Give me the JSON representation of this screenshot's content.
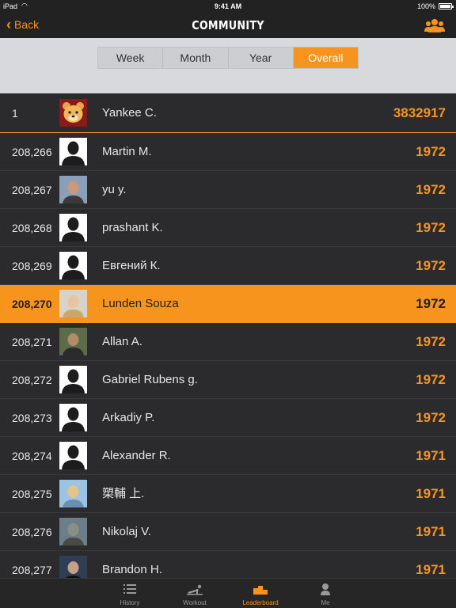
{
  "status_bar": {
    "carrier": "iPad",
    "time": "9:41 AM",
    "battery": "100%"
  },
  "nav": {
    "back_label": "Back",
    "title": "COMMUNITY",
    "right_icon": "group-icon"
  },
  "segments": [
    {
      "label": "Week",
      "active": false
    },
    {
      "label": "Month",
      "active": false
    },
    {
      "label": "Year",
      "active": false
    },
    {
      "label": "Overall",
      "active": true
    }
  ],
  "leaderboard": [
    {
      "rank": "1",
      "name": "Yankee C.",
      "score": "3832917",
      "avatar": "bear"
    },
    {
      "rank": "208,266",
      "name": "Martin M.",
      "score": "1972",
      "avatar": "silhouette"
    },
    {
      "rank": "208,267",
      "name": "yu y.",
      "score": "1972",
      "avatar": "photo"
    },
    {
      "rank": "208,268",
      "name": "prashant K.",
      "score": "1972",
      "avatar": "silhouette"
    },
    {
      "rank": "208,269",
      "name": "Евгений К.",
      "score": "1972",
      "avatar": "silhouette"
    },
    {
      "rank": "208,270",
      "name": "Lunden Souza",
      "score": "1972",
      "avatar": "photo"
    },
    {
      "rank": "208,271",
      "name": "Allan A.",
      "score": "1972",
      "avatar": "photo"
    },
    {
      "rank": "208,272",
      "name": "Gabriel Rubens g.",
      "score": "1972",
      "avatar": "silhouette"
    },
    {
      "rank": "208,273",
      "name": "Arkadiy P.",
      "score": "1972",
      "avatar": "silhouette"
    },
    {
      "rank": "208,274",
      "name": "Alexander R.",
      "score": "1971",
      "avatar": "silhouette"
    },
    {
      "rank": "208,275",
      "name": "槊輔 上.",
      "score": "1971",
      "avatar": "photo"
    },
    {
      "rank": "208,276",
      "name": "Nikolaj V.",
      "score": "1971",
      "avatar": "photo"
    },
    {
      "rank": "208,277",
      "name": "Brandon H.",
      "score": "1971",
      "avatar": "photo"
    }
  ],
  "tabs": [
    {
      "label": "History",
      "icon": "list-icon",
      "active": false
    },
    {
      "label": "Workout",
      "icon": "pushup-icon",
      "active": false
    },
    {
      "label": "Leaderboard",
      "icon": "podium-icon",
      "active": true
    },
    {
      "label": "Me",
      "icon": "person-icon",
      "active": false
    }
  ],
  "colors": {
    "accent": "#f7941d",
    "background": "#2b2b2d",
    "segment_bg": "#d8d9dc"
  }
}
